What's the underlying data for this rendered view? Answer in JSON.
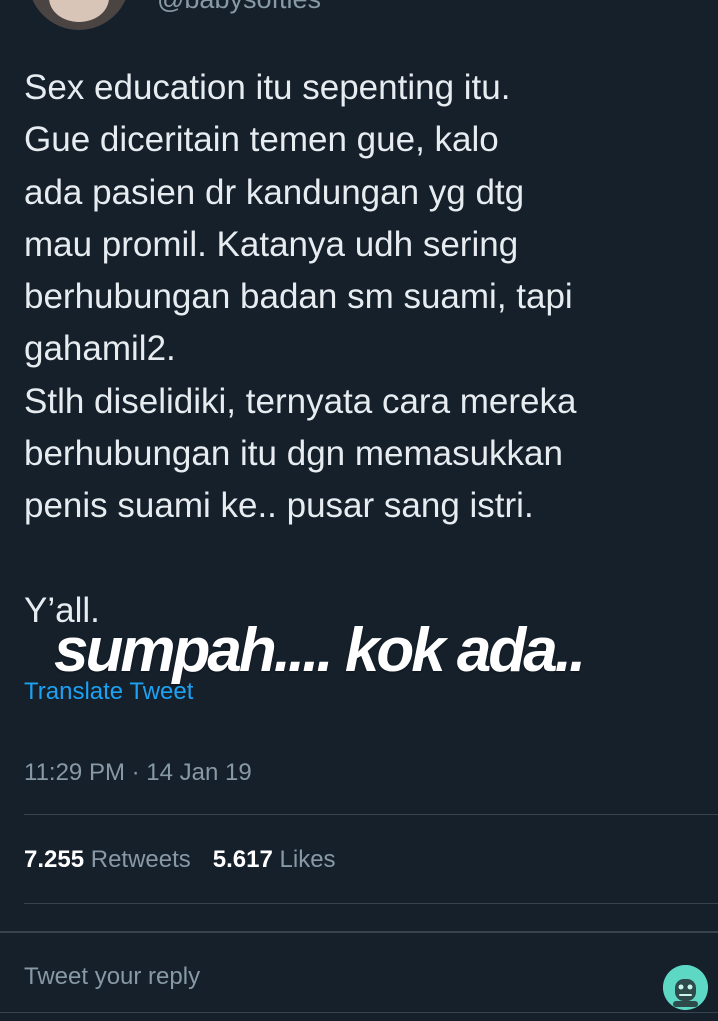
{
  "tweet": {
    "handle": "@babysofties",
    "lines": [
      "Sex education itu sepenting itu.",
      "Gue diceritain temen gue, kalo",
      "ada pasien dr kandungan yg dtg",
      "mau promil. Katanya udh sering",
      "berhubungan badan sm suami, tapi",
      "gahamil2.",
      "Stlh diselidiki, ternyata cara mereka",
      "berhubungan itu dgn memasukkan",
      "penis suami ke.. pusar sang istri.",
      "Y’all."
    ],
    "overlay_caption": "sumpah.... kok ada..",
    "translate_label": "Translate Tweet",
    "timestamp": "11:29 PM · 14 Jan 19",
    "stats": {
      "retweets_count": "7.255",
      "retweets_label": "Retweets",
      "likes_count": "5.617",
      "likes_label": "Likes"
    }
  },
  "reply": {
    "placeholder": "Tweet your reply"
  },
  "colors": {
    "background": "#15202b",
    "text": "#e7ecf0",
    "secondary": "#8899a6",
    "link": "#1da1f2",
    "divider": "#38444d"
  },
  "icons": {
    "author_avatar": "user-avatar",
    "reply_avatar": "bot-avatar-icon"
  }
}
